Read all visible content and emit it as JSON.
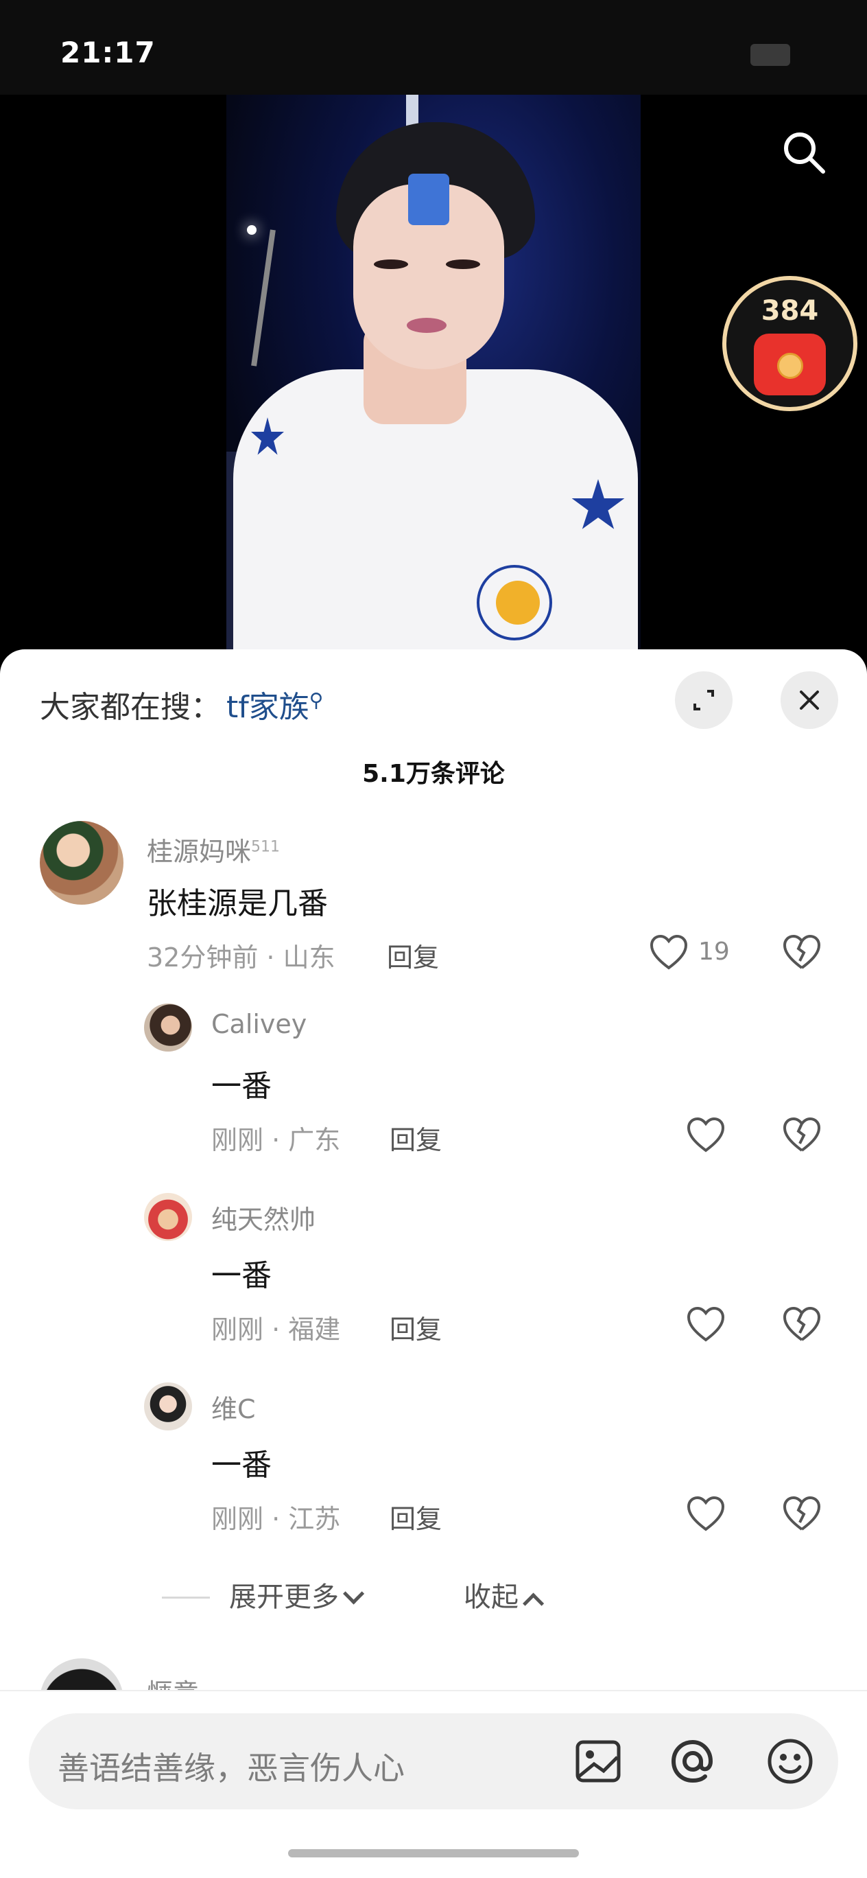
{
  "status_bar": {
    "time": "21:17"
  },
  "video": {
    "search_icon": "search-icon",
    "red_packet": {
      "count": "384",
      "icon": "red-envelope-icon"
    }
  },
  "comments_panel": {
    "trending_label": "大家都在搜：",
    "trending_term": "tf家族",
    "comment_count": "5.1万条评论",
    "comments": [
      {
        "author": "桂源妈咪",
        "author_sup": "511",
        "text": "张桂源是几番",
        "meta": "32分钟前 · 山东",
        "reply": "回复",
        "likes": "19"
      },
      {
        "author": "Calivey",
        "text": "一番",
        "meta": "刚刚 · 广东",
        "reply": "回复"
      },
      {
        "author": "纯天然帅",
        "text": "一番",
        "meta": "刚刚 · 福建",
        "reply": "回复"
      },
      {
        "author": "维C",
        "text": "一番",
        "meta": "刚刚 · 江苏",
        "reply": "回复"
      }
    ],
    "expand_more": "展开更多",
    "collapse": "收起",
    "partial_author": "惬意"
  },
  "input": {
    "placeholder": "善语结善缘，恶言伤人心",
    "icons": [
      "image-icon",
      "at-icon",
      "emoji-icon"
    ]
  },
  "colors": {
    "link": "#1f4e8c",
    "accent_gold": "#f2d7a6",
    "red": "#e8322c"
  }
}
